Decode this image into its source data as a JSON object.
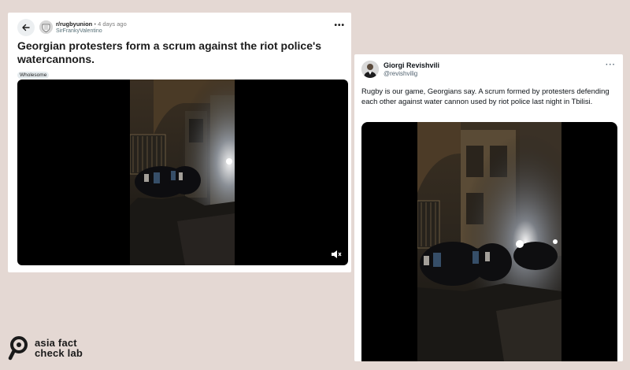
{
  "reddit": {
    "subreddit": "r/rugbyunion",
    "separator": "•",
    "time": "4 days ago",
    "username": "SirFrankyValentino",
    "title": "Georgian protesters form a scrum against the riot police's watercannons.",
    "flair": "Wholesome",
    "more_icon": "ellipsis-icon",
    "back_icon": "arrow-left-icon",
    "mute_icon": "speaker-muted-icon"
  },
  "tweet": {
    "author_name": "Giorgi Revishvili",
    "handle": "@revishvilig",
    "text": "Rugby is our game, Georgians say. A scrum formed by protesters defending each other against water cannon used by riot police last night in Tbilisi.",
    "more_icon": "ellipsis-icon"
  },
  "logo": {
    "line1": "asia fact",
    "line2": "check lab"
  }
}
